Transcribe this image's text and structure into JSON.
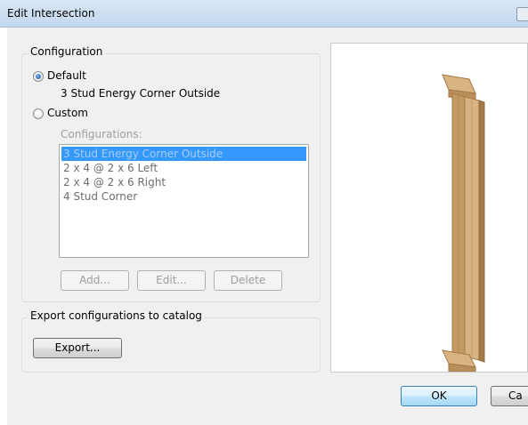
{
  "window": {
    "title": "Edit Intersection"
  },
  "configuration": {
    "group_label": "Configuration",
    "default_label": "Default",
    "default_value": "3 Stud Energy Corner Outside",
    "custom_label": "Custom",
    "configurations_label": "Configurations:",
    "items": [
      "3 Stud Energy Corner Outside",
      "2 x 4 @ 2 x 6 Left",
      "2 x 4 @ 2 x 6 Right",
      "4 Stud Corner"
    ],
    "selected_index": 0,
    "add_label": "Add...",
    "edit_label": "Edit...",
    "delete_label": "Delete"
  },
  "export": {
    "group_label": "Export configurations to catalog",
    "button_label": "Export..."
  },
  "footer": {
    "ok_label": "OK",
    "cancel_label": "Ca"
  },
  "colors": {
    "wood_light": "#d9b483",
    "wood_mid": "#c49a63",
    "wood_dark": "#a37a47",
    "selection": "#3399ff"
  }
}
